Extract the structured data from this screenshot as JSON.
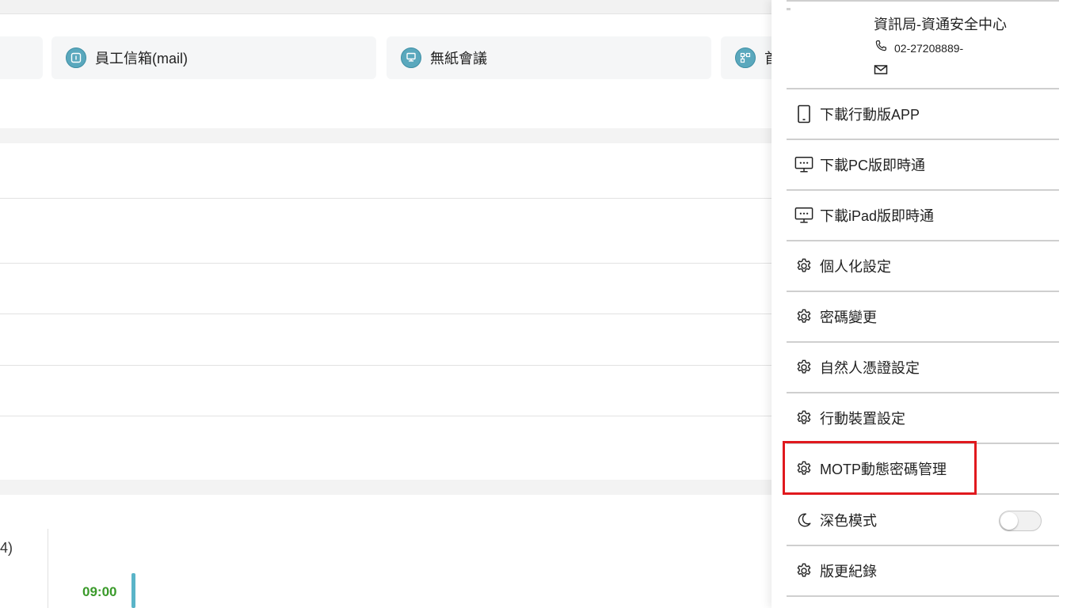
{
  "shortcuts": [
    {
      "label": "",
      "icon": "app-icon"
    },
    {
      "label": "員工信箱(mail)",
      "icon": "mail-app-icon"
    },
    {
      "label": "無紙會議",
      "icon": "meeting-icon"
    },
    {
      "label": "首",
      "icon": "org-chart-icon"
    }
  ],
  "background": {
    "partial_text": "4)",
    "time_label": "09:00"
  },
  "profile": {
    "org": "資訊局-資通安全中心",
    "phone": "02-27208889-",
    "email": ""
  },
  "menu": [
    {
      "label": "下載行動版APP",
      "icon": "mobile-phone-icon"
    },
    {
      "label": "下載PC版即時通",
      "icon": "monitor-chat-icon"
    },
    {
      "label": "下載iPad版即時通",
      "icon": "monitor-chat-icon"
    },
    {
      "label": "個人化設定",
      "icon": "gear-icon"
    },
    {
      "label": "密碼變更",
      "icon": "gear-icon"
    },
    {
      "label": "自然人憑證設定",
      "icon": "gear-icon"
    },
    {
      "label": "行動裝置設定",
      "icon": "gear-icon"
    },
    {
      "label": "MOTP動態密碼管理",
      "icon": "gear-icon",
      "highlighted": true
    },
    {
      "label": "深色模式",
      "icon": "moon-icon",
      "toggle": false
    },
    {
      "label": "版更紀錄",
      "icon": "gear-icon"
    }
  ],
  "colors": {
    "accent": "#5aa8bd",
    "highlight": "#e0191e",
    "time": "#3a9a2a"
  }
}
